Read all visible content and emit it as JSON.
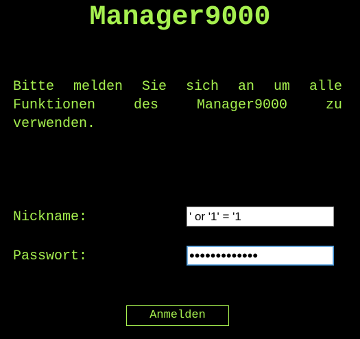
{
  "app": {
    "title": "Manager9000"
  },
  "intro": {
    "text": "Bitte melden Sie sich an um alle Funktionen des Manager9000 zu verwenden."
  },
  "form": {
    "nickname_label": "Nickname:",
    "nickname_value": "' or '1' = '1",
    "password_label": "Passwort:",
    "password_value": "•••••••••••••",
    "submit_label": "Anmelden"
  },
  "colors": {
    "background": "#000000",
    "accent": "#a6f04f"
  }
}
